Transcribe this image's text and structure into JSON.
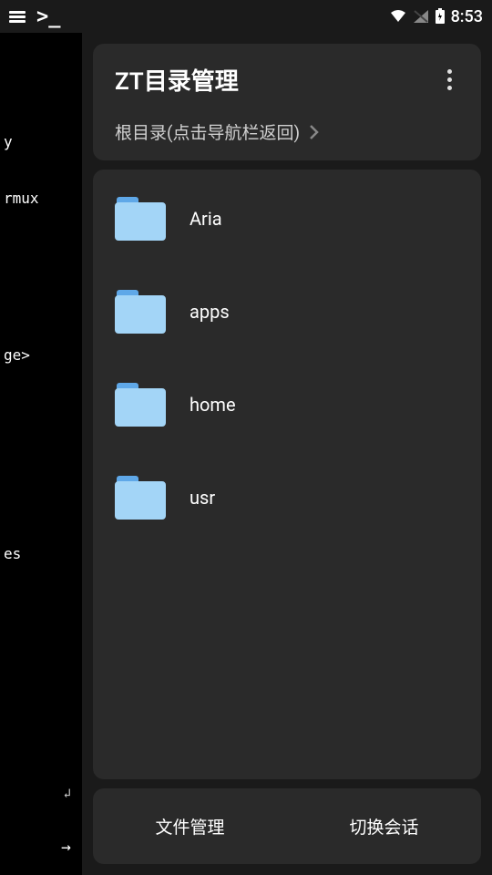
{
  "status": {
    "time": "8:53"
  },
  "sidebar": {
    "line1": "y",
    "line2": "rmux",
    "line3": "ge>",
    "line4": "es",
    "arrow_down": "↲",
    "arrow_right": "→"
  },
  "header": {
    "title": "ZT目录管理",
    "breadcrumb": "根目录(点击导航栏返回)"
  },
  "folders": [
    {
      "name": "Aria"
    },
    {
      "name": "apps"
    },
    {
      "name": "home"
    },
    {
      "name": "usr"
    }
  ],
  "buttons": {
    "file_manage": "文件管理",
    "switch_session": "切换会话"
  }
}
